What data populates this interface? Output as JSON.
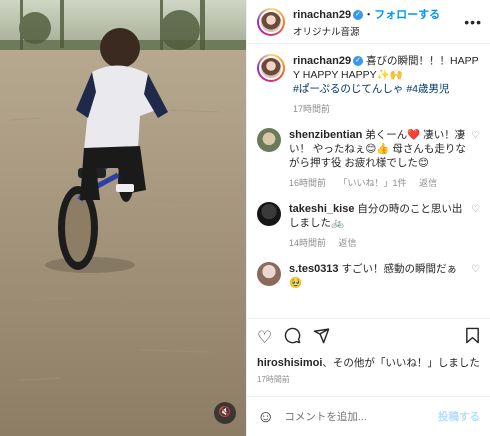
{
  "header": {
    "username": "rinachan29",
    "follow_label": "フォローする",
    "sep": "・",
    "audio": "オリジナル音源",
    "more": "•••"
  },
  "caption": {
    "username": "rinachan29",
    "text": "喜びの瞬間！！！HAPPY HAPPY HAPPY✨🙌",
    "tags": "#ぱーぷるのじてんしゃ #4歳男児",
    "time": "17時間前"
  },
  "comments": [
    {
      "username": "shenzibentian",
      "text": "弟くーん❤️ 凄い！凄い！ やったねぇ😊👍 母さんも走りながら押す役 お疲れ様でした😊",
      "time": "16時間前",
      "likes": "「いいね！」1件",
      "reply": "返信"
    },
    {
      "username": "takeshi_kise",
      "text": "自分の時のこと思い出しました🚲",
      "time": "14時間前",
      "reply": "返信"
    },
    {
      "username": "s.tes0313",
      "text": "すごい！感動の瞬間だぁ🥹"
    }
  ],
  "likes_line": {
    "user": "hiroshisimoi",
    "text": "、その他が「いいね！」しました"
  },
  "post_time": "17時間前",
  "composer": {
    "placeholder": "コメントを追加...",
    "post_label": "投稿する"
  },
  "colors": {
    "link": "#0095f6",
    "verified": "#3897f0",
    "muted": "#8e8e8e"
  },
  "icons": [
    "heart-icon",
    "comment-icon",
    "share-icon",
    "bookmark-icon",
    "emoji-icon",
    "speaker-muted-icon"
  ]
}
